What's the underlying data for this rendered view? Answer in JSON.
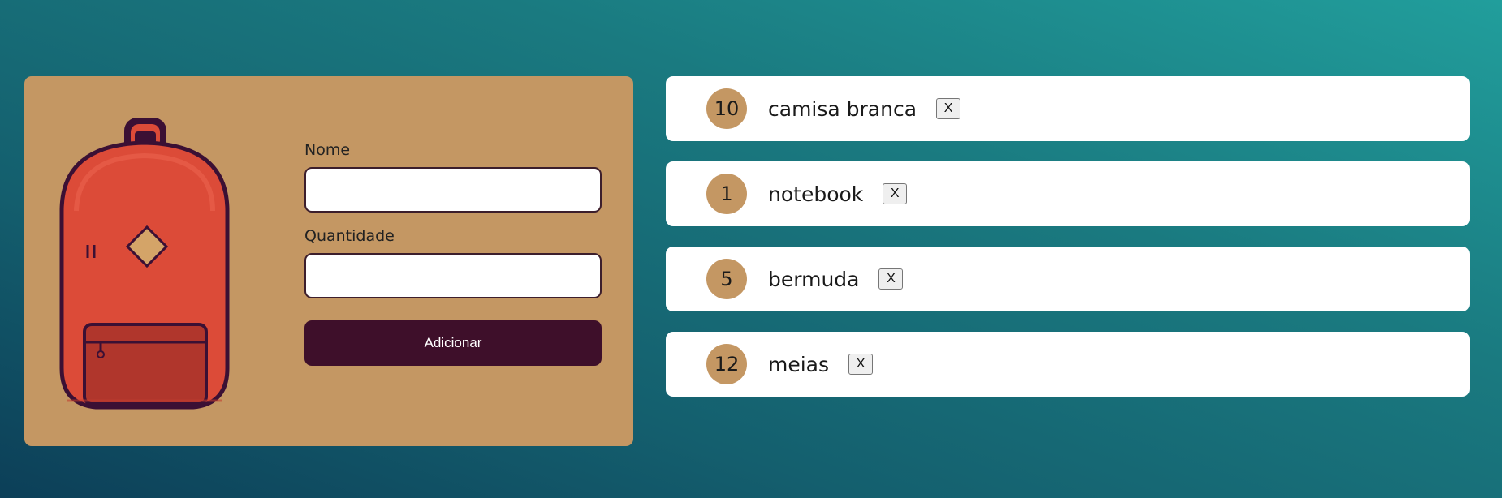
{
  "form": {
    "name_label": "Nome",
    "name_value": "",
    "quantity_label": "Quantidade",
    "quantity_value": "",
    "submit_label": "Adicionar"
  },
  "items": [
    {
      "quantity": "10",
      "name": "camisa branca",
      "delete_label": "X"
    },
    {
      "quantity": "1",
      "name": "notebook",
      "delete_label": "X"
    },
    {
      "quantity": "5",
      "name": "bermuda",
      "delete_label": "X"
    },
    {
      "quantity": "12",
      "name": "meias",
      "delete_label": "X"
    }
  ],
  "colors": {
    "card_bg": "#c49763",
    "button_bg": "#3e0f2a",
    "backpack_body": "#dc4b38",
    "backpack_pocket": "#b0362c",
    "backpack_outline": "#3b1034"
  }
}
